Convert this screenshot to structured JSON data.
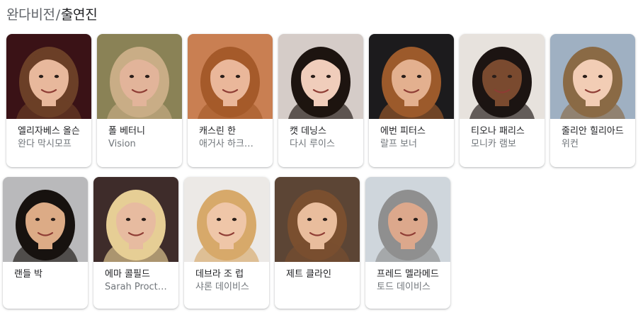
{
  "breadcrumb": {
    "parent": "완다비전",
    "separator": "/",
    "current": "출연진"
  },
  "cast": [
    {
      "name": "엘리자베스 올슨",
      "role": "완다 막시모프",
      "skin": "#e8b89c",
      "hair": "#6b3f27",
      "bg": "#3a1216"
    },
    {
      "name": "폴 베터니",
      "role": "Vision",
      "skin": "#e2b49a",
      "hair": "#c9ad86",
      "bg": "#8a8256"
    },
    {
      "name": "캐스린 한",
      "role": "애거사 하크…",
      "skin": "#eab79a",
      "hair": "#a55a2a",
      "bg": "#c97f52"
    },
    {
      "name": "캣 데닝스",
      "role": "다시 루이스",
      "skin": "#f0cdbb",
      "hair": "#1d1410",
      "bg": "#d5ccc8"
    },
    {
      "name": "에번 피터스",
      "role": "랄프 보너",
      "skin": "#e3b08f",
      "hair": "#9c5a2b",
      "bg": "#1c1b1d"
    },
    {
      "name": "티오나 패리스",
      "role": "모니카 램보",
      "skin": "#7a4a2f",
      "hair": "#1c1412",
      "bg": "#e7e2dd"
    },
    {
      "name": "줄리안 힐리아드",
      "role": "위컨",
      "skin": "#f2cdb5",
      "hair": "#8a6a45",
      "bg": "#9fb0c2"
    },
    {
      "name": "랜들 박",
      "role": "",
      "skin": "#dcab86",
      "hair": "#17120f",
      "bg": "#b9b9bb"
    },
    {
      "name": "에마 콜필드",
      "role": "Sarah Proct…",
      "skin": "#e7bba0",
      "hair": "#e6ce95",
      "bg": "#3e2c2a"
    },
    {
      "name": "데브라 조 럽",
      "role": "샤론 데이비스",
      "skin": "#efc6a8",
      "hair": "#d7a96a",
      "bg": "#ece9e6"
    },
    {
      "name": "제트 클라인",
      "role": "",
      "skin": "#e9bd9d",
      "hair": "#7a4f2f",
      "bg": "#5c4535"
    },
    {
      "name": "프레드 멜라메드",
      "role": "토드 데이비스",
      "skin": "#dca88c",
      "hair": "#8f8f8f",
      "bg": "#cfd6dc"
    }
  ]
}
